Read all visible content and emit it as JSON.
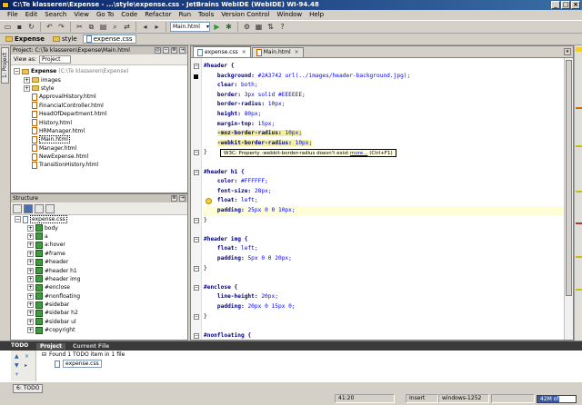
{
  "window": {
    "title": "C:\\Te klasseren\\Expense - ...\\style\\expense.css - JetBrains WebIDE (WebIDE) WI-94.48"
  },
  "menu": [
    "File",
    "Edit",
    "Search",
    "View",
    "Go To",
    "Code",
    "Refactor",
    "Run",
    "Tools",
    "Version Control",
    "Window",
    "Help"
  ],
  "toolbar": {
    "run_config": "Main.html"
  },
  "breadcrumbs": [
    "Expense",
    "style",
    "expense.css"
  ],
  "project_panel": {
    "header": "Project: C:\\Te klasseren\\Expense\\Main.html",
    "view_as_label": "View as:",
    "view_as_value": "Project",
    "root_name": "Expense",
    "root_path": "(C:\\Te klasseren\\Expense)",
    "folders": [
      "images",
      "style"
    ],
    "files": [
      "ApprovalHistory.html",
      "FinancialController.html",
      "HeadOfDepartment.html",
      "History.html",
      "HRManager.html",
      "Main.html",
      "Manager.html",
      "NewExpense.html",
      "TransitionHistory.html"
    ]
  },
  "structure_panel": {
    "header": "Structure",
    "root": "expense.css",
    "items": [
      "body",
      "a",
      "a:hover",
      "#frame",
      "#header",
      "#header h1",
      "#header img",
      "#enclose",
      "#nonfloating",
      "#sidebar",
      "#sidebar h2",
      "#sidebar ul",
      "#copyright"
    ]
  },
  "editor": {
    "tabs": [
      {
        "label": "expense.css",
        "active": true
      },
      {
        "label": "Main.html",
        "active": false
      }
    ],
    "lines": [
      {
        "kind": "sel",
        "text": "#header {"
      },
      {
        "kind": "prop",
        "prop": "background:",
        "value": " #2A3742 url(../images/header-background.jpg);"
      },
      {
        "kind": "prop",
        "prop": "clear:",
        "value": " both;"
      },
      {
        "kind": "prop",
        "prop": "border:",
        "value": " 3px solid #EEEEEE;"
      },
      {
        "kind": "prop",
        "prop": "border-radius:",
        "value": " 10px;"
      },
      {
        "kind": "prop",
        "prop": "height:",
        "value": " 80px;"
      },
      {
        "kind": "prop",
        "prop": "margin-top:",
        "value": " 15px;"
      },
      {
        "kind": "warn",
        "prop": "-moz-border-radius:",
        "value": " 10px;"
      },
      {
        "kind": "warn",
        "prop": "-webkit-border-radius:",
        "value": " 10px;"
      },
      {
        "kind": "end",
        "text": "}"
      },
      {
        "kind": "blank",
        "text": ""
      },
      {
        "kind": "sel",
        "text": "#header h1 {"
      },
      {
        "kind": "prop",
        "prop": "color:",
        "value": " #FFFFFF;"
      },
      {
        "kind": "prop",
        "prop": "font-size:",
        "value": " 28px;"
      },
      {
        "kind": "prop",
        "prop": "float:",
        "value": " left;"
      },
      {
        "kind": "prop",
        "prop": "padding:",
        "value": " 25px 0 0 10px;"
      },
      {
        "kind": "end",
        "text": "}"
      },
      {
        "kind": "blank",
        "text": ""
      },
      {
        "kind": "sel",
        "text": "#header img {"
      },
      {
        "kind": "prop",
        "prop": "float:",
        "value": " left;"
      },
      {
        "kind": "prop",
        "prop": "padding:",
        "value": " 5px 0 0 20px;"
      },
      {
        "kind": "end",
        "text": "}"
      },
      {
        "kind": "blank",
        "text": ""
      },
      {
        "kind": "sel",
        "text": "#enclose {"
      },
      {
        "kind": "prop",
        "prop": "line-height:",
        "value": " 20px;"
      },
      {
        "kind": "prop",
        "prop": "padding:",
        "value": " 20px 0 15px 0;"
      },
      {
        "kind": "end",
        "text": "}"
      },
      {
        "kind": "blank",
        "text": ""
      },
      {
        "kind": "sel",
        "text": "#nonfloating {"
      },
      {
        "kind": "prop",
        "prop": "clear:",
        "value": " both;"
      },
      {
        "kind": "end",
        "text": "}"
      },
      {
        "kind": "blank",
        "text": ""
      },
      {
        "kind": "sel",
        "text": "#sidebar {"
      }
    ],
    "tooltip_prefix": "W3C: Property -webkit-border-radius doesn't exist ",
    "tooltip_link": "more...",
    "tooltip_suffix": " (Ctrl+F1)"
  },
  "todo_panel": {
    "label": "TODO",
    "tabs": [
      "Project",
      "Current File"
    ],
    "summary": "Found 1 TODO item in 1 file",
    "file": "expense.css"
  },
  "statusbar": {
    "tab": "6: TODO",
    "position": "41:20",
    "mode": "Insert",
    "encoding": "windows-1252",
    "memory_text": "42M of 73M",
    "memory_used_fraction": 0.58
  }
}
